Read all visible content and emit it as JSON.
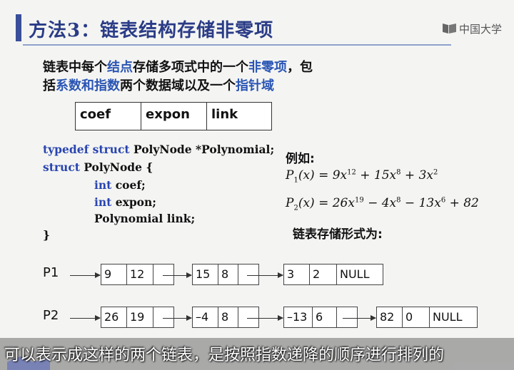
{
  "slide": {
    "title": "方法3：链表结构存储非零项",
    "logo_text": "中国大学",
    "intro_line1": [
      "链表中每个",
      "结点",
      "存储多项式中的一个",
      "非零项",
      "，包"
    ],
    "intro_line2": [
      "括",
      "系数和指数",
      "两个数据域以及一个",
      "指针域"
    ],
    "fields": [
      "coef",
      "expon",
      "link"
    ],
    "code": {
      "line1_kw": "typedef struct",
      "line1_rest": " PolyNode *Polynomial;",
      "line2_kw": "struct",
      "line2_rest": " PolyNode {",
      "line3_kw": "int",
      "line3_rest": " coef;",
      "line4_kw": "int",
      "line4_rest": " expon;",
      "line5": "Polynomial link;",
      "line6": "}"
    },
    "example_label": "例如:",
    "formula1": {
      "lhs": "P",
      "lhs_sub": "1",
      "lhs_arg": "(x) = 9x",
      "e1": "12",
      "t2": " + 15x",
      "e2": "8",
      "t3": " + 3x",
      "e3": "2"
    },
    "formula2": {
      "lhs": "P",
      "lhs_sub": "2",
      "lhs_arg": "(x) = 26x",
      "e1": "19",
      "t2": " − 4x",
      "e2": "8",
      "t3": " − 13x",
      "e3": "6",
      "t4": " + 82"
    },
    "storage_label": "链表存储形式为:",
    "lists": [
      {
        "name": "P1",
        "nodes": [
          {
            "coef": "9",
            "expon": "12",
            "link": ""
          },
          {
            "coef": "15",
            "expon": "8",
            "link": ""
          },
          {
            "coef": "3",
            "expon": "2",
            "link": "NULL"
          }
        ]
      },
      {
        "name": "P2",
        "nodes": [
          {
            "coef": "26",
            "expon": "19",
            "link": ""
          },
          {
            "coef": "–4",
            "expon": "8",
            "link": ""
          },
          {
            "coef": "–13",
            "expon": "6",
            "link": ""
          },
          {
            "coef": "82",
            "expon": "0",
            "link": "NULL"
          }
        ]
      }
    ]
  },
  "subtitle": "可以表示成这样的两个链表，是按照指数递降的顺序进行排列的"
}
